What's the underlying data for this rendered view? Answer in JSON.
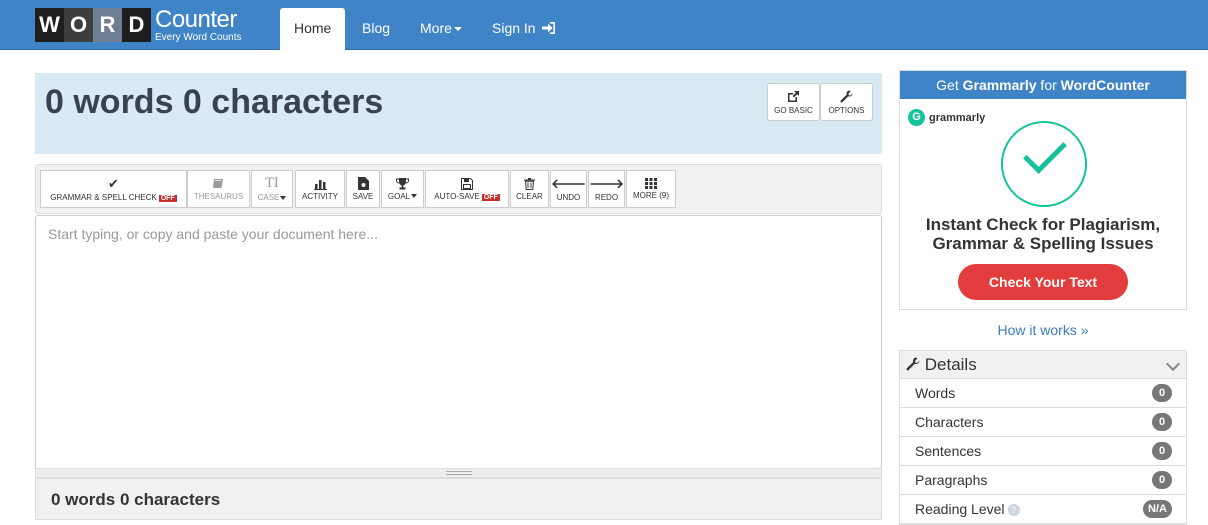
{
  "nav": {
    "logo_letters": [
      "W",
      "O",
      "R",
      "D"
    ],
    "logo_word": "Counter",
    "logo_tagline": "Every Word Counts",
    "items": [
      {
        "label": "Home"
      },
      {
        "label": "Blog"
      },
      {
        "label": "More"
      },
      {
        "label": "Sign In"
      }
    ]
  },
  "header": {
    "count_title": "0 words 0 characters",
    "go_basic": "GO BASIC",
    "options": "OPTIONS"
  },
  "toolbar": {
    "grammar": "GRAMMAR & SPELL CHECK",
    "grammar_state": "OFF",
    "thesaurus": "THESAURUS",
    "case": "CASE",
    "activity": "ACTIVITY",
    "save": "SAVE",
    "goal": "GOAL",
    "autosave": "AUTO-SAVE",
    "autosave_state": "OFF",
    "clear": "CLEAR",
    "undo": "UNDO",
    "redo": "REDO",
    "more": "MORE (9)"
  },
  "editor": {
    "placeholder": "Start typing, or copy and paste your document here..."
  },
  "footer": {
    "count": "0 words 0 characters"
  },
  "ad": {
    "head_pre": "Get ",
    "head_brand": "Grammarly",
    "head_mid": " for ",
    "head_site": "WordCounter",
    "brand_small": "grammarly",
    "line1": "Instant Check for Plagiarism,",
    "line2": "Grammar & Spelling Issues",
    "button": "Check Your Text",
    "how": "How it works »"
  },
  "details": {
    "title": "Details",
    "rows": [
      {
        "label": "Words",
        "value": "0"
      },
      {
        "label": "Characters",
        "value": "0"
      },
      {
        "label": "Sentences",
        "value": "0"
      },
      {
        "label": "Paragraphs",
        "value": "0"
      },
      {
        "label": "Reading Level",
        "value": "N/A"
      }
    ]
  },
  "colors": {
    "nav_blue": "#3f84c7",
    "panel_blue": "#d9eaf5",
    "grammarly_green": "#15c39a",
    "cta_red": "#e23d3c"
  }
}
